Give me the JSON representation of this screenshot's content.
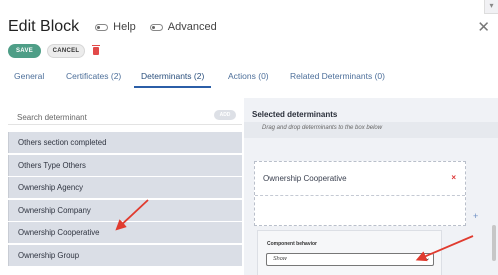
{
  "header": {
    "title": "Edit Block",
    "toggles": [
      {
        "label": "Help",
        "icon": "toggle-switch-icon"
      },
      {
        "label": "Advanced",
        "icon": "toggle-switch-icon"
      }
    ],
    "close_icon": "close-icon",
    "corner_icon": "chevron-down-icon"
  },
  "actions": {
    "save_label": "SAVE",
    "cancel_label": "CANCEL",
    "delete_icon": "trash-icon"
  },
  "tabs": [
    {
      "label": "General",
      "active": false
    },
    {
      "label": "Certificates (2)",
      "active": false
    },
    {
      "label": "Determinants (2)",
      "active": true
    },
    {
      "label": "Actions (0)",
      "active": false
    },
    {
      "label": "Related Determinants (0)",
      "active": false
    }
  ],
  "left_panel": {
    "search_placeholder": "Search determinant",
    "add_label": "ADD",
    "items": [
      "Others section completed",
      "Others Type Others",
      "Ownership Agency",
      "Ownership Company",
      "Ownership Cooperative",
      "Ownership Group"
    ]
  },
  "right_panel": {
    "title": "Selected determinants",
    "hint": "Drag and drop determinants to the box below",
    "selected": [
      {
        "label": "Ownership Cooperative",
        "remove": "×"
      }
    ],
    "add_icon": "+",
    "component_behavior": {
      "label": "Component behavior",
      "value": "Show",
      "chevron": "⌄"
    }
  },
  "colors": {
    "accent": "#4e9e87",
    "tab_active": "#2b5ea7",
    "delete": "#e24a4a",
    "annotation_arrow": "#e03b2f"
  }
}
